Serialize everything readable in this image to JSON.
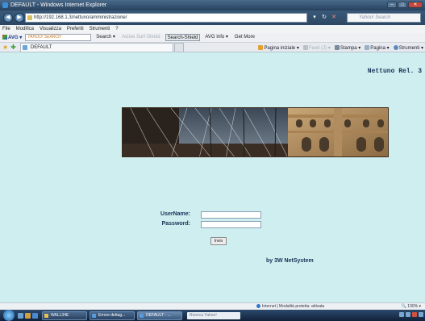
{
  "window": {
    "title": "DEFAULT - Windows Internet Explorer"
  },
  "address_bar": {
    "url": "http://192.168.1.3/nettuno/amministrazione/",
    "search_placeholder": "Yahoo! Search"
  },
  "menu": [
    "File",
    "Modifica",
    "Visualizza",
    "Preferiti",
    "Strumenti",
    "?"
  ],
  "avg_toolbar": {
    "logo": "AVG",
    "search_brand": "YAHOO! SEARCH",
    "search_label": "Search",
    "disabled_item": "Active Surf-Shield",
    "search_shield": "Search-Shield",
    "avg_info": "AVG Info",
    "get_more": "Get More"
  },
  "tab": {
    "title": "DEFAULT"
  },
  "command_bar": {
    "home": "Pagina iniziale",
    "feeds": "Feed (J)",
    "print": "Stampa",
    "page": "Pagina",
    "tools": "Strumenti"
  },
  "page": {
    "product_name": "Nettuno Rel. 3",
    "username_label": "UserName:",
    "password_label": "Password:",
    "submit_label": "Invio",
    "byline": "by 3W NetSystem",
    "username_value": "",
    "password_value": ""
  },
  "status_bar": {
    "zone": "Internet | Modalità protetta: attivata",
    "zoom": "100%"
  },
  "taskbar": {
    "tasks": [
      "WALL34E",
      "Errore dettag...",
      "DEFAULT - ..."
    ],
    "search_placeholder": "Ricerca Yahoo!"
  },
  "colors": {
    "page_background": "#cfeef0",
    "label_text": "#1a3158"
  }
}
